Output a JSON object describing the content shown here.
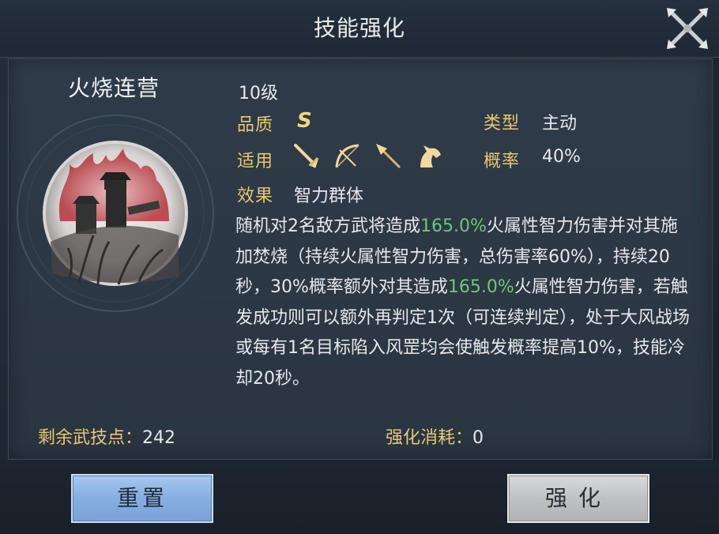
{
  "window": {
    "title": "技能强化"
  },
  "skill": {
    "name": "火烧连营",
    "level": "10级",
    "quality_label": "品质",
    "quality_value": "S",
    "type_label": "类型",
    "type_value": "主动",
    "applies_label": "适用",
    "applies_icons": [
      "sword-icon",
      "bow-icon",
      "spear-icon",
      "horse-icon"
    ],
    "rate_label": "概率",
    "rate_value": "40%",
    "effect_label": "效果",
    "effect_value": "智力群体",
    "description": [
      {
        "text": "随机对2名敌方武将造成",
        "highlight": false
      },
      {
        "text": "165.0%",
        "highlight": true
      },
      {
        "text": "火属性智力伤害并对其施加焚烧（持续火属性智力伤害，总伤害率60%），持续20秒，30%概率额外对其造成",
        "highlight": false
      },
      {
        "text": "165.0%",
        "highlight": true
      },
      {
        "text": "火属性智力伤害，若触发成功则可以额外再判定1次（可连续判定），处于大风战场或每有1名目标陷入风罡均会使触发概率提高10%，技能冷却20秒。",
        "highlight": false
      }
    ],
    "colors": {
      "label": "#e8c872",
      "highlight": "#6ec67a",
      "text": "#e6e9ec"
    }
  },
  "footer": {
    "points_label": "剩余武技点：",
    "points_value": "242",
    "cost_label": "强化消耗：",
    "cost_value": "0",
    "reset_label": "重置",
    "enhance_label": "强化"
  }
}
